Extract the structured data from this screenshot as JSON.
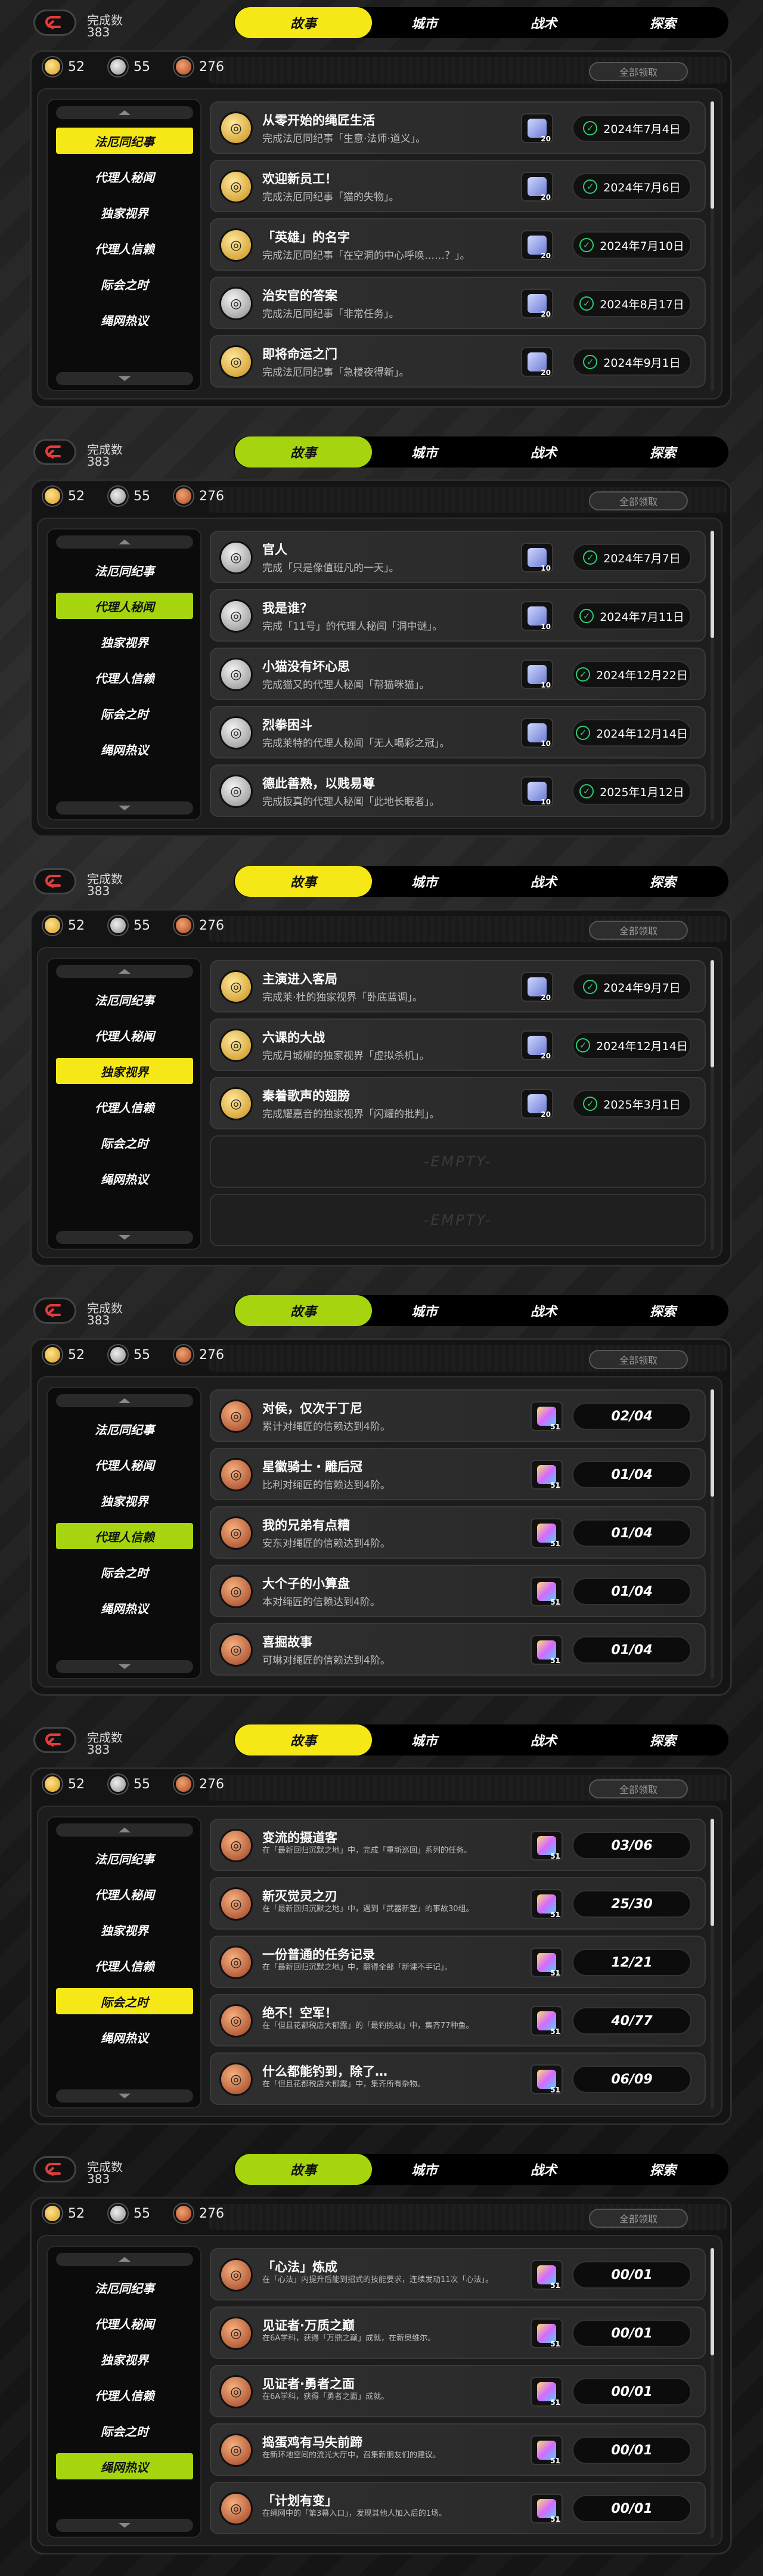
{
  "colors": {
    "yellow": "#f6e817",
    "lime": "#a6d50f",
    "ok": "#2ecc71"
  },
  "common": {
    "stat_label": "完成数",
    "stat_value": "383",
    "tabs": [
      "故事",
      "城市",
      "战术",
      "探索"
    ],
    "resources": [
      "52",
      "55",
      "276"
    ],
    "claim_all": "全部领取",
    "nav": [
      "法厄同纪事",
      "代理人秘闻",
      "独家视界",
      "代理人信赖",
      "际会之时",
      "绳网热议"
    ],
    "empty": "-EMPTY-"
  },
  "screens": [
    {
      "accent": "yellow",
      "nav_selected": 0,
      "rows": [
        {
          "icon": "gold-medal-icon",
          "title": "从零开始的绳匠生活",
          "desc": "完成法厄同纪事「生意·法师·道义」。",
          "reward": "20",
          "date": "2024年7月4日"
        },
        {
          "icon": "gold-medal-icon",
          "title": "欢迎新员工！",
          "desc": "完成法厄同纪事「猫的失物」。",
          "reward": "20",
          "date": "2024年7月6日"
        },
        {
          "icon": "gold-medal-icon",
          "title": "「英雄」的名字",
          "desc": "完成法厄同纪事「在空洞的中心呼唤……？」。",
          "reward": "20",
          "date": "2024年7月10日"
        },
        {
          "icon": "silver-medal-icon",
          "title": "治安官的答案",
          "desc": "完成法厄同纪事「非常任务」。",
          "reward": "20",
          "date": "2024年8月17日"
        },
        {
          "icon": "gold-medal-icon",
          "title": "即将命运之门",
          "desc": "完成法厄同纪事「急楼夜得新」。",
          "reward": "20",
          "date": "2024年9月1日"
        }
      ]
    },
    {
      "accent": "lime",
      "nav_selected": 1,
      "rows": [
        {
          "icon": "silver-medal-icon",
          "title": "官人",
          "desc": "完成「只是像值班凡的一天」。",
          "reward": "10",
          "date": "2024年7月7日"
        },
        {
          "icon": "silver-medal-icon",
          "title": "我是谁？",
          "desc": "完成「11号」的代理人秘闻「洞中谜」。",
          "reward": "10",
          "date": "2024年7月11日"
        },
        {
          "icon": "silver-medal-icon",
          "title": "小猫没有坏心思",
          "desc": "完成猫又的代理人秘闻「帮猫咪猫」。",
          "reward": "10",
          "date": "2024年12月22日"
        },
        {
          "icon": "silver-medal-icon",
          "title": "烈拳困斗",
          "desc": "完成莱特的代理人秘闻「无人喝彩之冠」。",
          "reward": "10",
          "date": "2024年12月14日"
        },
        {
          "icon": "silver-medal-icon",
          "title": "德此善熟，以贱易尊",
          "desc": "完成扳真的代理人秘闻「此地长眠者」。",
          "reward": "10",
          "date": "2025年1月12日"
        }
      ]
    },
    {
      "accent": "yellow",
      "nav_selected": 2,
      "rows": [
        {
          "icon": "gold-medal-icon",
          "title": "主演进入客局",
          "desc": "完成莱·杜的独家视界「卧底蓝调」。",
          "reward": "20",
          "date": "2024年9月7日"
        },
        {
          "icon": "gold-medal-icon",
          "title": "六课的大战",
          "desc": "完成月城柳的独家视界「虚拟杀机」。",
          "reward": "20",
          "date": "2024年12月14日"
        },
        {
          "icon": "gold-medal-icon",
          "title": "秦着歌声的翅膀",
          "desc": "完成耀嘉音的独家视界「闪耀的批判」。",
          "reward": "20",
          "date": "2025年3月1日"
        }
      ],
      "empty_rows": 2
    },
    {
      "accent": "lime",
      "nav_selected": 3,
      "rows": [
        {
          "icon": "bronze-medal-icon",
          "title": "对侯，仅次于丁尼",
          "desc": "累计对绳匠的信赖达到4阶。",
          "reward": "51",
          "progress": "02/04"
        },
        {
          "icon": "bronze-medal-icon",
          "title": "星徽骑士・雕后冠",
          "desc": "比利对绳匠的信赖达到4阶。",
          "reward": "51",
          "progress": "01/04"
        },
        {
          "icon": "bronze-medal-icon",
          "title": "我的兄弟有点糟",
          "desc": "安东对绳匠的信赖达到4阶。",
          "reward": "51",
          "progress": "01/04"
        },
        {
          "icon": "bronze-medal-icon",
          "title": "大个子的小算盘",
          "desc": "本对绳匠的信赖达到4阶。",
          "reward": "51",
          "progress": "01/04"
        },
        {
          "icon": "bronze-medal-icon",
          "title": "喜掘故事",
          "desc": "可琳对绳匠的信赖达到4阶。",
          "reward": "51",
          "progress": "01/04"
        }
      ]
    },
    {
      "accent": "yellow",
      "nav_selected": 4,
      "rows": [
        {
          "icon": "bronze-medal-icon",
          "title": "变流的摄道客",
          "desc": "在「最新回归沉默之地」中，完成「重新巡回」系列的任务。",
          "reward": "51",
          "progress": "03/06"
        },
        {
          "icon": "bronze-medal-icon",
          "title": "新灭觉灵之刃",
          "desc": "在「最新回归沉默之地」中，遇到「武器新型」的事故30组。",
          "reward": "51",
          "progress": "25/30"
        },
        {
          "icon": "bronze-medal-icon",
          "title": "一份普通的任务记录",
          "desc": "在「最新回归沉默之地」中，翻得全部「新课不手记」。",
          "reward": "51",
          "progress": "12/21"
        },
        {
          "icon": "bronze-medal-icon",
          "title": "绝不！空军！",
          "desc": "在「但且花都税店大郁露」的「最钓挑战」中，集齐77种鱼。",
          "reward": "51",
          "progress": "40/77"
        },
        {
          "icon": "bronze-medal-icon",
          "title": "什么都能钓到，除了…",
          "desc": "在「但且花都税店大郁露」中，集齐所有杂物。",
          "reward": "51",
          "progress": "06/09"
        }
      ]
    },
    {
      "accent": "lime",
      "nav_selected": 5,
      "rows": [
        {
          "icon": "bronze-medal-icon",
          "title": "「心法」炼成",
          "desc": "在「心法」内提升后能到招式的技能要求，连续发动11次「心法」。",
          "reward": "51",
          "progress": "00/01"
        },
        {
          "icon": "bronze-medal-icon",
          "title": "见证者·万质之巅",
          "desc": "在6A学科，获得「万鼎之巅」成就，在新奥维尔。",
          "reward": "51",
          "progress": "00/01"
        },
        {
          "icon": "bronze-medal-icon",
          "title": "见证者·勇者之面",
          "desc": "在6A学科，获得「勇者之面」成就。",
          "reward": "51",
          "progress": "00/01"
        },
        {
          "icon": "bronze-medal-icon",
          "title": "捣蛋鸡有马失前蹄",
          "desc": "在新环地空间的流光大厅中，召集新朋友们的建议。",
          "reward": "51",
          "progress": "00/01"
        },
        {
          "icon": "bronze-medal-icon",
          "title": "「计划有变」",
          "desc": "在绳网中的「第3幕入口」，发现其他人加入后的1场。",
          "reward": "51",
          "progress": "00/01"
        }
      ]
    }
  ]
}
